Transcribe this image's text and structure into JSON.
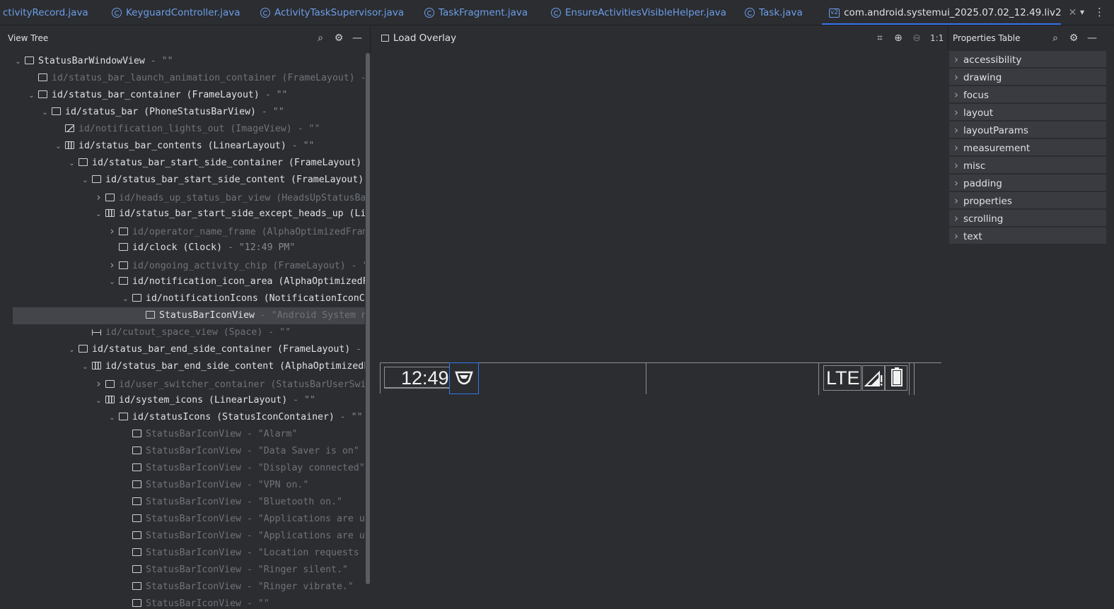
{
  "tabs": [
    {
      "label": "ctivityRecord.java",
      "active": false
    },
    {
      "label": "KeyguardController.java",
      "active": false
    },
    {
      "label": "ActivityTaskSupervisor.java",
      "active": false
    },
    {
      "label": "TaskFragment.java",
      "active": false
    },
    {
      "label": "EnsureActivitiesVisibleHelper.java",
      "active": false
    },
    {
      "label": "Task.java",
      "active": false
    },
    {
      "label": "com.android.systemui_2025.07.02_12.49.liv2",
      "active": true,
      "badge": "v2"
    }
  ],
  "view_tree": {
    "title": "View Tree",
    "rows": [
      {
        "name": "StatusBarWindowView",
        "desc": " - \"\""
      },
      {
        "name": "id/status_bar_launch_animation_container (FrameLayout)",
        "desc": " - \"\""
      },
      {
        "name": "id/status_bar_container (FrameLayout)",
        "desc": " - \"\""
      },
      {
        "name": "id/status_bar (PhoneStatusBarView)",
        "desc": " - \"\""
      },
      {
        "name": "id/notification_lights_out (ImageView)",
        "desc": " - \"\""
      },
      {
        "name": "id/status_bar_contents (LinearLayout)",
        "desc": " - \"\""
      },
      {
        "name": "id/status_bar_start_side_container (FrameLayout)",
        "desc": ""
      },
      {
        "name": "id/status_bar_start_side_content (FrameLayout)",
        "desc": ""
      },
      {
        "name": "id/heads_up_status_bar_view (HeadsUpStatusBa",
        "desc": ""
      },
      {
        "name": "id/status_bar_start_side_except_heads_up (Li",
        "desc": ""
      },
      {
        "name": "id/operator_name_frame (AlphaOptimizedFram",
        "desc": ""
      },
      {
        "name": "id/clock (Clock)",
        "desc": " - \"12:49 PM\""
      },
      {
        "name": "id/ongoing_activity_chip (FrameLayout)",
        "desc": " - \""
      },
      {
        "name": "id/notification_icon_area (AlphaOptimizedF",
        "desc": ""
      },
      {
        "name": "id/notificationIcons (NotificationIconCo",
        "desc": ""
      },
      {
        "name": "StatusBarIconView",
        "desc": " - \"Android System no"
      },
      {
        "name": "id/cutout_space_view (Space)",
        "desc": " - \"\""
      },
      {
        "name": "id/status_bar_end_side_container (FrameLayout)",
        "desc": " -"
      },
      {
        "name": "id/status_bar_end_side_content (AlphaOptimizedL",
        "desc": ""
      },
      {
        "name": "id/user_switcher_container (StatusBarUserSwi",
        "desc": ""
      },
      {
        "name": "id/system_icons (LinearLayout)",
        "desc": " - \"\""
      },
      {
        "name": "id/statusIcons (StatusIconContainer)",
        "desc": " - \"\""
      },
      {
        "name": "StatusBarIconView",
        "desc": " - \"Alarm\""
      },
      {
        "name": "StatusBarIconView",
        "desc": " - \"Data Saver is on\""
      },
      {
        "name": "StatusBarIconView",
        "desc": " - \"Display connected\""
      },
      {
        "name": "StatusBarIconView",
        "desc": " - \"VPN on.\""
      },
      {
        "name": "StatusBarIconView",
        "desc": " - \"Bluetooth on.\""
      },
      {
        "name": "StatusBarIconView",
        "desc": " - \"Applications are us"
      },
      {
        "name": "StatusBarIconView",
        "desc": " - \"Applications are us"
      },
      {
        "name": "StatusBarIconView",
        "desc": " - \"Location requests a"
      },
      {
        "name": "StatusBarIconView",
        "desc": " - \"Ringer silent.\""
      },
      {
        "name": "StatusBarIconView",
        "desc": " - \"Ringer vibrate.\""
      },
      {
        "name": "StatusBarIconView",
        "desc": " - \"\""
      }
    ]
  },
  "overlay": {
    "load_label": "Load Overlay",
    "zoom_label": "1:1",
    "clock_text": "12:49",
    "lte_text": "LTE"
  },
  "properties": {
    "title": "Properties Table",
    "sections": [
      "accessibility",
      "drawing",
      "focus",
      "layout",
      "layoutParams",
      "measurement",
      "misc",
      "padding",
      "properties",
      "scrolling",
      "text"
    ]
  },
  "colors": {
    "background": "#2b2d30",
    "selection": "#43454a",
    "accent": "#3574f0",
    "tab_link": "#6d9eea"
  }
}
